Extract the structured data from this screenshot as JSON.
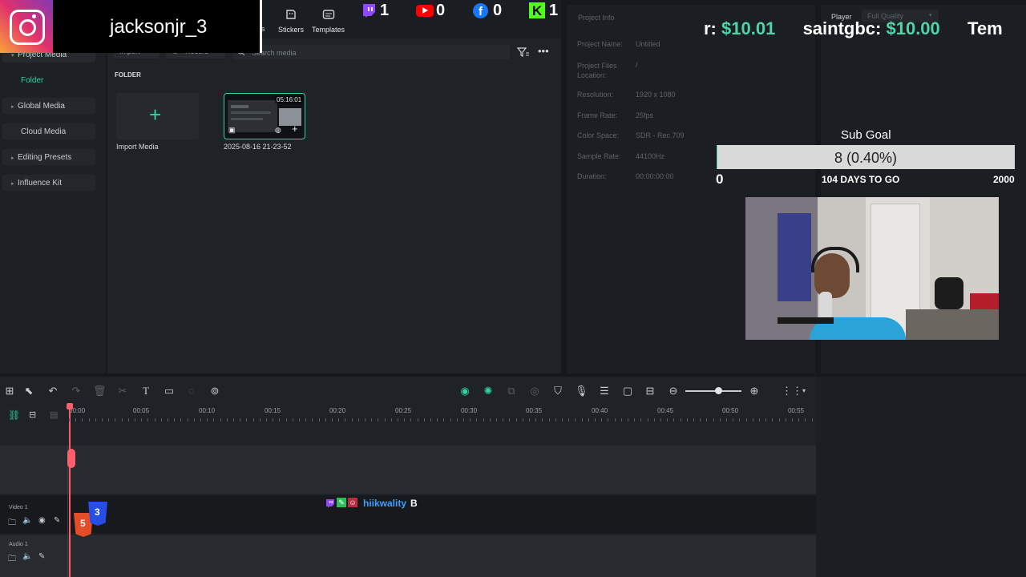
{
  "overlay": {
    "username": "jacksonjr_3",
    "social_counts": {
      "twitch": "1",
      "youtube": "0",
      "facebook": "0",
      "kick": "1"
    },
    "ticker": [
      {
        "name": "r:",
        "amount": "$10.01"
      },
      {
        "name": "saintgbc:",
        "amount": "$10.00"
      },
      {
        "name": "Tem",
        "amount": ""
      }
    ],
    "sub_goal": {
      "title": "Sub Goal",
      "progress_text": "8 (0.40%)",
      "progress_fraction": 0.004,
      "min": "0",
      "days_to_go": "104 DAYS TO GO",
      "max": "2000"
    },
    "chat": {
      "username": "hiikwality",
      "message": "B"
    }
  },
  "toolbar_top": {
    "partial_tab": "s",
    "stickers": "Stickers",
    "templates": "Templates"
  },
  "media": {
    "import_btn": "Import",
    "record_btn": "Record",
    "search_placeholder": "Search media",
    "folder_header": "FOLDER",
    "import_media_label": "Import Media",
    "clip": {
      "duration": "05:16:01",
      "name": "2025-08-16 21-23-52"
    }
  },
  "sidebar": {
    "items": [
      {
        "label": "Project Media"
      },
      {
        "label": "Folder"
      },
      {
        "label": "Global Media"
      },
      {
        "label": "Cloud Media"
      },
      {
        "label": "Editing Presets"
      },
      {
        "label": "Influence Kit"
      }
    ]
  },
  "project_info": {
    "title": "Project Info",
    "rows": [
      {
        "label": "Project Name:",
        "value": "Untitled"
      },
      {
        "label": "Project Files Location:",
        "value": "/"
      },
      {
        "label": "Resolution:",
        "value": "1920 x 1080"
      },
      {
        "label": "Frame Rate:",
        "value": "25fps"
      },
      {
        "label": "Color Space:",
        "value": "SDR - Rec.709"
      },
      {
        "label": "Sample Rate:",
        "value": "44100Hz"
      },
      {
        "label": "Duration:",
        "value": "00:00:00:00"
      }
    ]
  },
  "player": {
    "label": "Player",
    "quality": "Full Quality"
  },
  "timeline": {
    "ticks": [
      "00:00",
      "00:05",
      "00:10",
      "00:15",
      "00:20",
      "00:25",
      "00:30",
      "00:35",
      "00:40",
      "00:45",
      "00:50",
      "00:55"
    ],
    "tracks": {
      "video": "Video 1",
      "audio": "Audio 1"
    }
  },
  "colors": {
    "accent": "#2fd3a5",
    "twitch": "#9146ff",
    "youtube": "#ff0000",
    "facebook": "#1877f2",
    "kick": "#53fc18",
    "playhead": "#ff5f6d"
  }
}
